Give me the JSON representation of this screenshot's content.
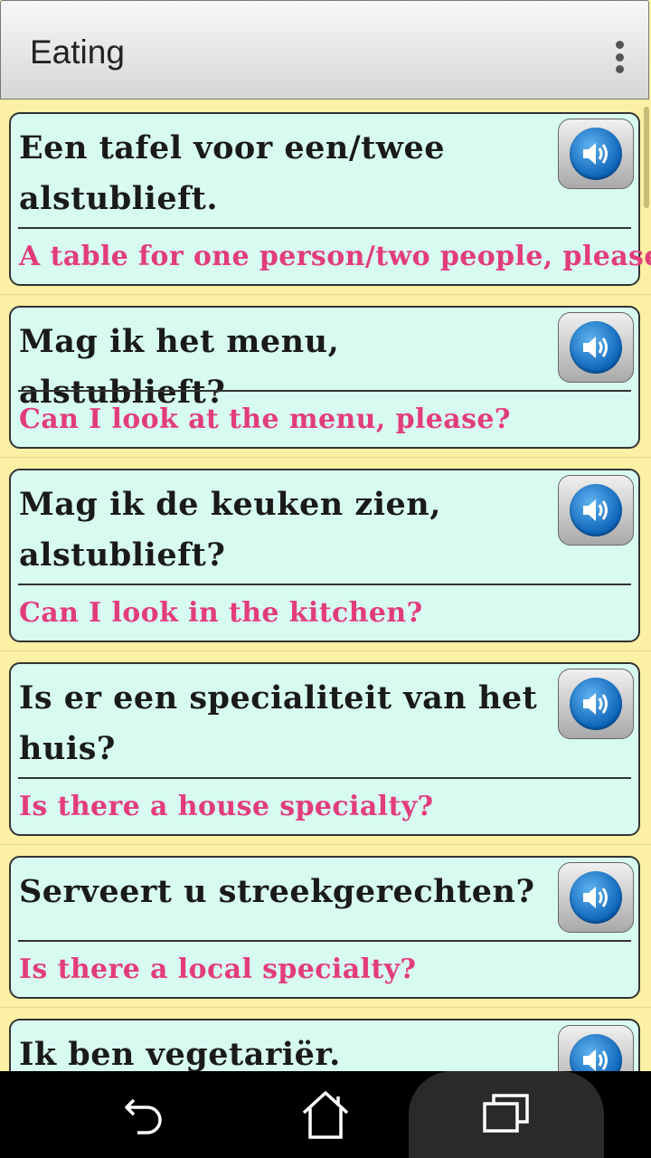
{
  "appbar": {
    "title": "Eating",
    "menu_icon": "overflow-menu-icon"
  },
  "phrases": [
    {
      "nl": "Een tafel voor een/twee alstublieft.",
      "en": "A table for one person/two people, please."
    },
    {
      "nl": "Mag ik het menu, alstublieft?",
      "en": "Can I look at the menu, please?"
    },
    {
      "nl": "Mag ik de keuken zien, alstublieft?",
      "en": "Can I look in the kitchen?"
    },
    {
      "nl": "Is er een specialiteit van het huis?",
      "en": "Is there a house specialty?"
    },
    {
      "nl": "Serveert u streekgerechten?",
      "en": "Is there a local specialty?"
    },
    {
      "nl": "Ik ben vegetariër.",
      "en": ""
    }
  ],
  "speak_icon": "speaker-icon",
  "navbar": {
    "back_icon": "back-icon",
    "home_icon": "home-icon",
    "recents_icon": "recents-icon"
  }
}
